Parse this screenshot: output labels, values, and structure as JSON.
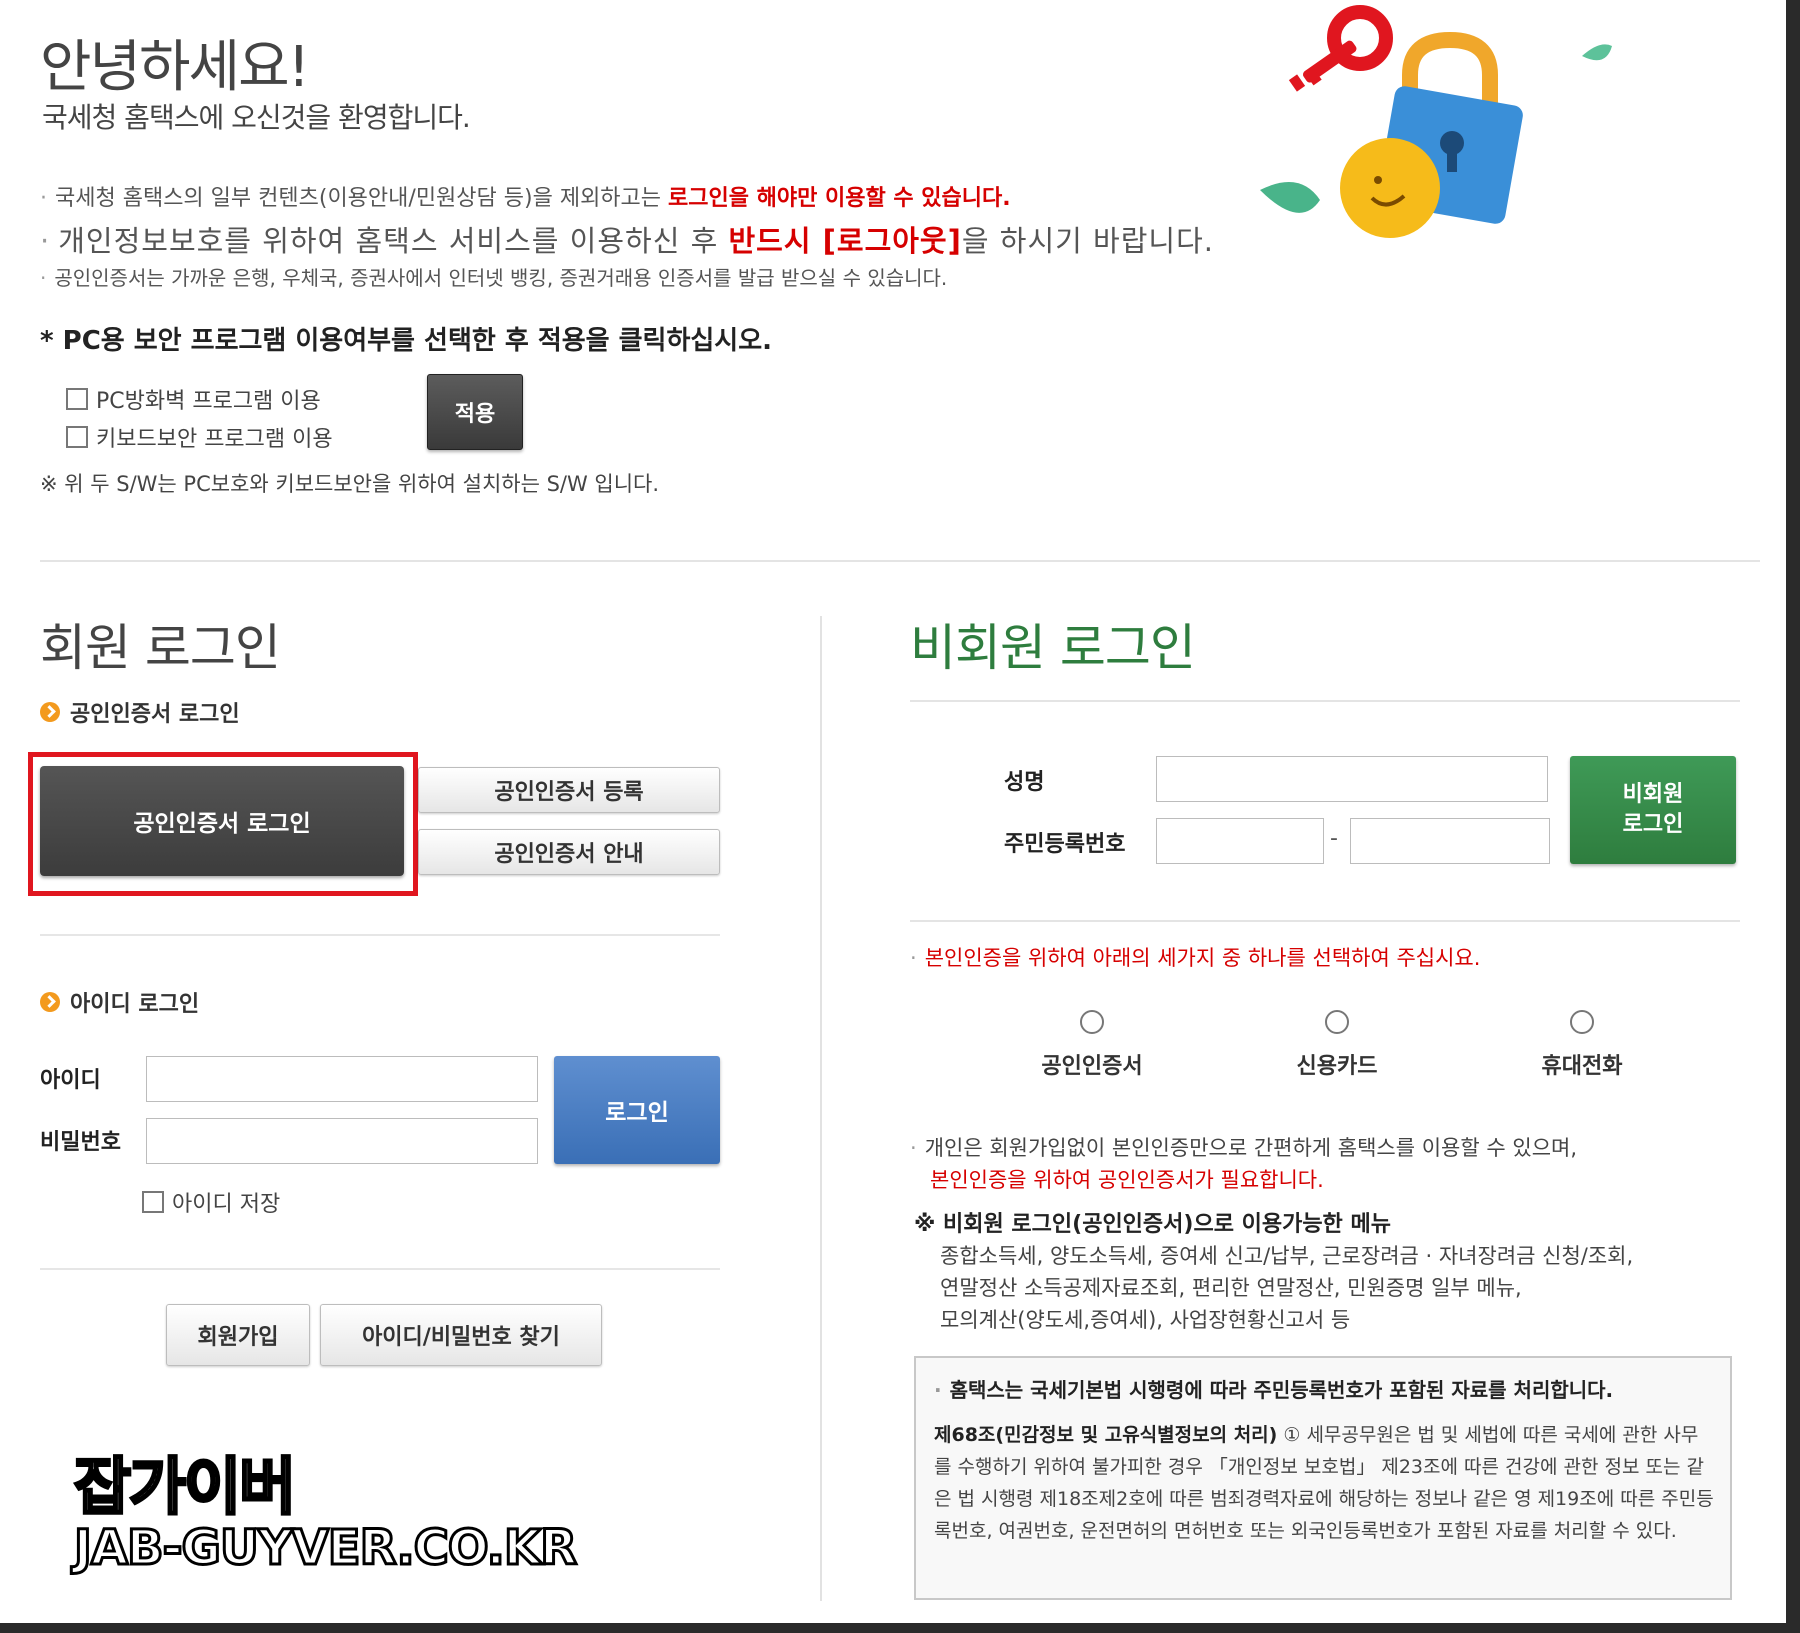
{
  "greeting": {
    "title": "안녕하세요!",
    "subtitle": "국세청 홈택스에 오신것을 환영합니다."
  },
  "notices": {
    "n1_text": "국세청 홈택스의 일부 컨텐츠(이용안내/민원상담 등)을 제외하고는 ",
    "n1_red": "로그인을 해야만 이용할 수 있습니다.",
    "n2_text": "개인정보보호를 위하여 홈택스 서비스를 이용하신 후 ",
    "n2_red": "반드시 [로그아웃]",
    "n2_tail": "을 하시기 바랍니다.",
    "n3_text": "공인인증서는 가까운 은행, 우체국, 증권사에서 인터넷 뱅킹, 증권거래용 인증서를 발급 받으실 수 있습니다."
  },
  "security": {
    "heading": "* PC용 보안 프로그램 이용여부를 선택한 후 적용을 클릭하십시오.",
    "option_firewall": "PC방화벽 프로그램 이용",
    "option_keyboard": "키보드보안 프로그램 이용",
    "apply_label": "적용",
    "note": "※ 위 두 S/W는 PC보호와 키보드보안을 위하여 설치하는 S/W 입니다."
  },
  "member": {
    "title": "회원 로그인",
    "cert_heading": "공인인증서 로그인",
    "cert_login_label": "공인인증서 로그인",
    "cert_register_label": "공인인증서 등록",
    "cert_info_label": "공인인증서 안내",
    "id_heading": "아이디 로그인",
    "id_label": "아이디",
    "pw_label": "비밀번호",
    "id_value": "",
    "pw_value": "",
    "login_label": "로그인",
    "save_id_label": "아이디 저장",
    "join_label": "회원가입",
    "find_label": "아이디/비밀번호 찾기"
  },
  "guest": {
    "title": "비회원 로그인",
    "name_label": "성명",
    "rrn_label": "주민등록번호",
    "name_value": "",
    "rrn_front_value": "",
    "rrn_back_value": "",
    "dash": "-",
    "login_line1": "비회원",
    "login_line2": "로그인",
    "verify_note": "본인인증을 위하여 아래의 세가지 중 하나를 선택하여 주십시요.",
    "methods": [
      "공인인증서",
      "신용카드",
      "휴대전화"
    ],
    "info1": "개인은 회원가입없이 본인인증만으로 간편하게 홈택스를 이용할 수 있으며,",
    "info2": "본인인증을 위하여 공인인증서가 필요합니다.",
    "menu_heading": "※ 비회원 로그인(공인인증서)으로 이용가능한 메뉴",
    "menu_lines": [
      "종합소득세, 양도소득세, 증여세 신고/납부, 근로장려금 · 자녀장려금 신청/조회,",
      "연말정산 소득공제자료조회, 편리한 연말정산, 민원증명 일부 메뉴,",
      "모의계산(양도세,증여세), 사업장현황신고서 등"
    ],
    "law_heading": "홈택스는 국세기본법 시행령에 따라 주민등록번호가 포함된 자료를 처리합니다.",
    "law_title": "제68조(민감정보 및 고유식별정보의 처리)",
    "law_text": " ① 세무공무원은 법 및 세법에 따른 국세에 관한 사무를 수행하기 위하여 불가피한 경우 「개인정보 보호법」 제23조에 따른 건강에 관한 정보 또는 같은 법 시행령 제18조제2호에 따른 범죄경력자료에 해당하는 정보나 같은 영 제19조에 따른 주민등록번호, 여권번호, 운전면허의 면허번호 또는 외국인등록번호가 포함된 자료를 처리할 수 있다."
  },
  "watermark": {
    "line1": "잡가이버",
    "line2": "JAB-GUYVER.CO.KR"
  },
  "colors": {
    "red": "#d60000",
    "guest_green": "#2e7d3e",
    "login_blue": "#3a6fb6",
    "highlight": "#e0161f",
    "orange_bullet": "#f39a1e"
  },
  "icons": [
    "key-icon",
    "padlock-icon",
    "smiley-icon",
    "leaf-icon",
    "check-circle-icon"
  ]
}
